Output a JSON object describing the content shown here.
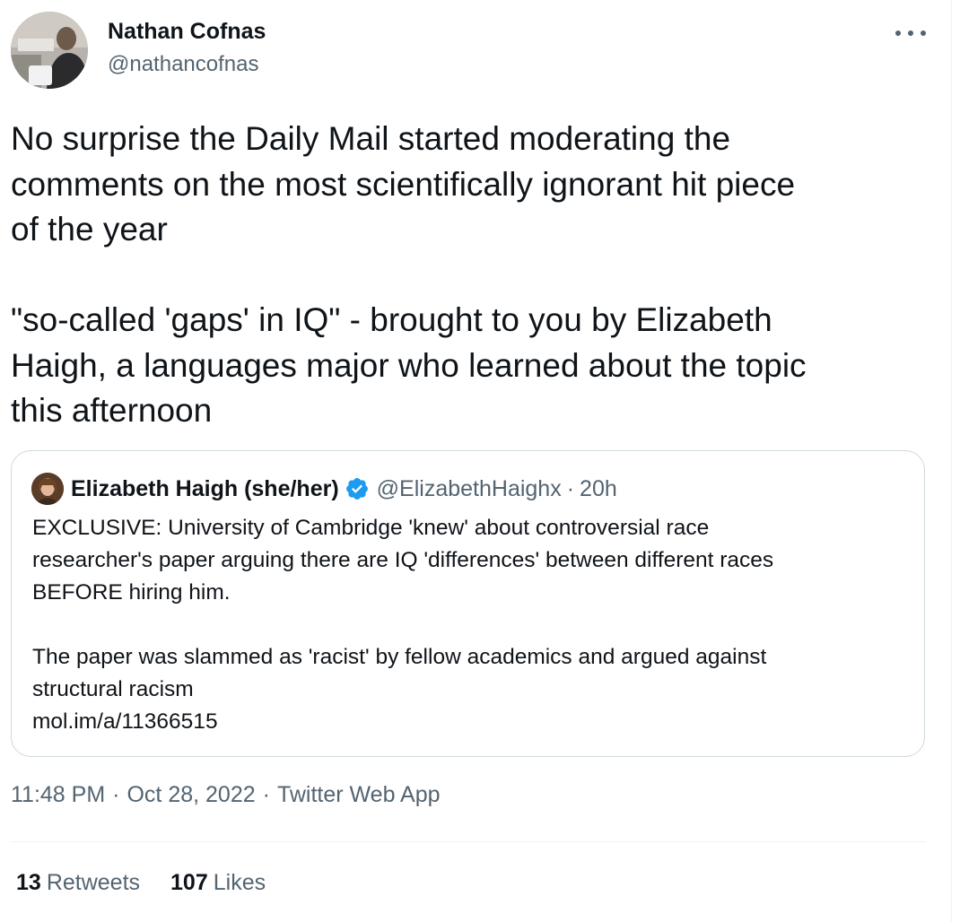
{
  "author": {
    "display_name": "Nathan Cofnas",
    "handle": "@nathancofnas",
    "avatar_icon": "profile-photo"
  },
  "tweet": {
    "text": "No surprise the Daily Mail started moderating the\ncomments on the most scientifically ignorant hit piece\nof the year\n\n\"so-called 'gaps' in IQ\" - brought to you by Elizabeth\nHaigh, a languages major who learned about the topic\nthis afternoon"
  },
  "quote": {
    "display_name": "Elizabeth Haigh (she/her)",
    "verified_icon": "verified-badge-icon",
    "handle": "@ElizabethHaighx",
    "separator": "·",
    "time": "20h",
    "text": "EXCLUSIVE: University of Cambridge 'knew' about controversial race\nresearcher's paper arguing there are IQ 'differences' between different races\nBEFORE hiring him.\n\nThe paper was slammed as 'racist' by fellow academics and argued against\nstructural racism\nmol.im/a/11366515"
  },
  "meta": {
    "time": "11:48 PM",
    "date": "Oct 28, 2022",
    "source": "Twitter Web App",
    "separator": "·"
  },
  "stats": {
    "retweets_count": "13",
    "retweets_label": "Retweets",
    "likes_count": "107",
    "likes_label": "Likes"
  },
  "colors": {
    "text_primary": "#0f1419",
    "text_secondary": "#536471",
    "border": "#cfd9de",
    "verified": "#1d9bf0"
  }
}
